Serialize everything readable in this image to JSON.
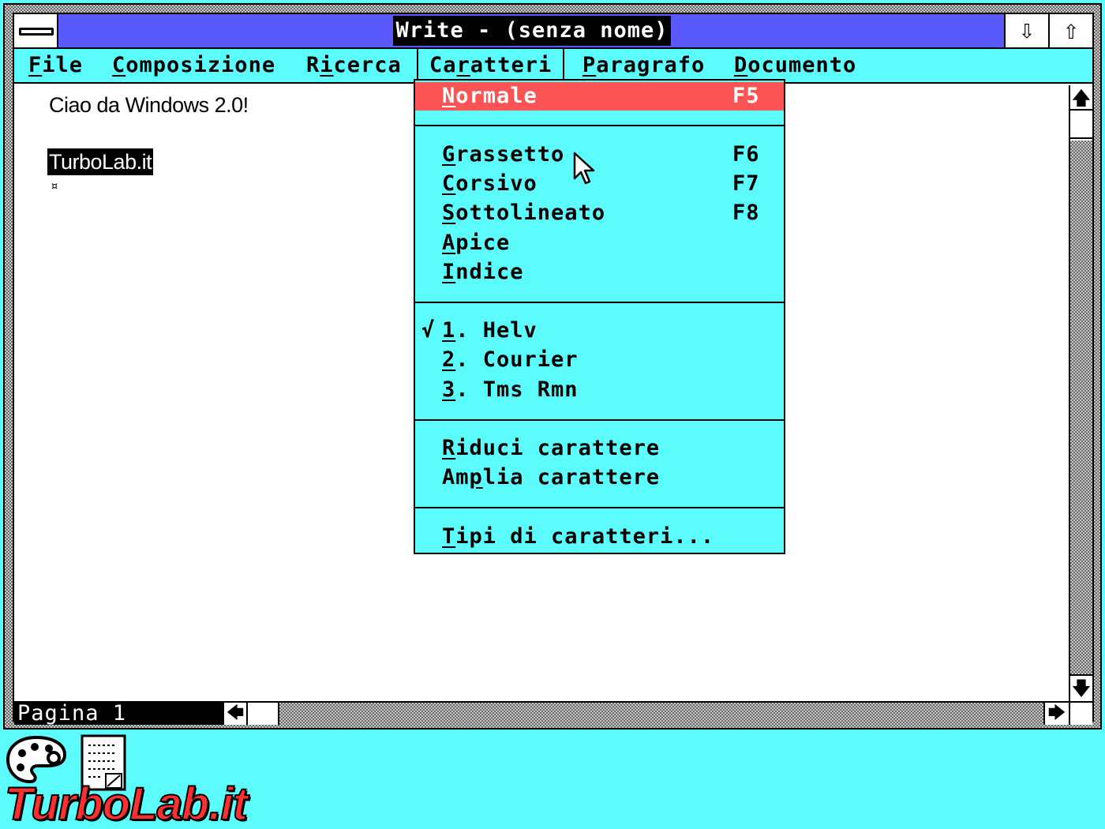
{
  "window": {
    "title": "Write - (senza nome)"
  },
  "menubar": {
    "items": [
      {
        "label": "File",
        "mnemonic": "F",
        "rest": "ile"
      },
      {
        "label": "Composizione",
        "mnemonic": "C",
        "rest": "omposizione"
      },
      {
        "label": "Ricerca",
        "pre": "R",
        "mnemonic": "i",
        "rest": "cerca"
      },
      {
        "label": "Caratteri",
        "pre": "Ca",
        "mnemonic": "r",
        "rest": "atteri"
      },
      {
        "label": "Paragrafo",
        "mnemonic": "P",
        "rest": "aragrafo"
      },
      {
        "label": "Documento",
        "mnemonic": "D",
        "rest": "ocumento"
      }
    ]
  },
  "document": {
    "line1": "Ciao da Windows 2.0!",
    "line2": "TurboLab.it",
    "end_mark": "¤"
  },
  "status": {
    "page": "Pagina  1"
  },
  "dropdown": {
    "normale": {
      "mnemonic": "N",
      "rest": "ormale",
      "accel": "F5"
    },
    "grassetto": {
      "mnemonic": "G",
      "rest": "rassetto",
      "accel": "F6"
    },
    "corsivo": {
      "mnemonic": "C",
      "rest": "orsivo",
      "accel": "F7"
    },
    "sottolineato": {
      "mnemonic": "S",
      "rest": "ottolineato",
      "accel": "F8"
    },
    "apice": {
      "mnemonic": "A",
      "rest": "pice"
    },
    "indice": {
      "mnemonic": "I",
      "rest": "ndice"
    },
    "fonts": [
      {
        "mnemonic": "1",
        "rest": ". Helv",
        "checked": true
      },
      {
        "mnemonic": "2",
        "rest": ". Courier",
        "checked": false
      },
      {
        "mnemonic": "3",
        "rest": ". Tms Rmn",
        "checked": false
      }
    ],
    "check_mark": "√",
    "riduci": {
      "mnemonic": "R",
      "rest": "iduci carattere"
    },
    "amplia": {
      "pre": "Am",
      "mnemonic": "p",
      "rest": "lia carattere"
    },
    "tipi": {
      "mnemonic": "T",
      "rest": "ipi di caratteri..."
    }
  },
  "icons": {
    "minimize": "⇩",
    "maximize": "⇧",
    "scroll_up": "🡅",
    "scroll_down": "🡇",
    "scroll_left": "🡄",
    "scroll_right": "🡆"
  },
  "watermark": "TurboLab.it",
  "colors": {
    "desktop": "#5cfcfc",
    "titlebar": "#5a5afc",
    "menu_highlight": "#fc5454"
  }
}
